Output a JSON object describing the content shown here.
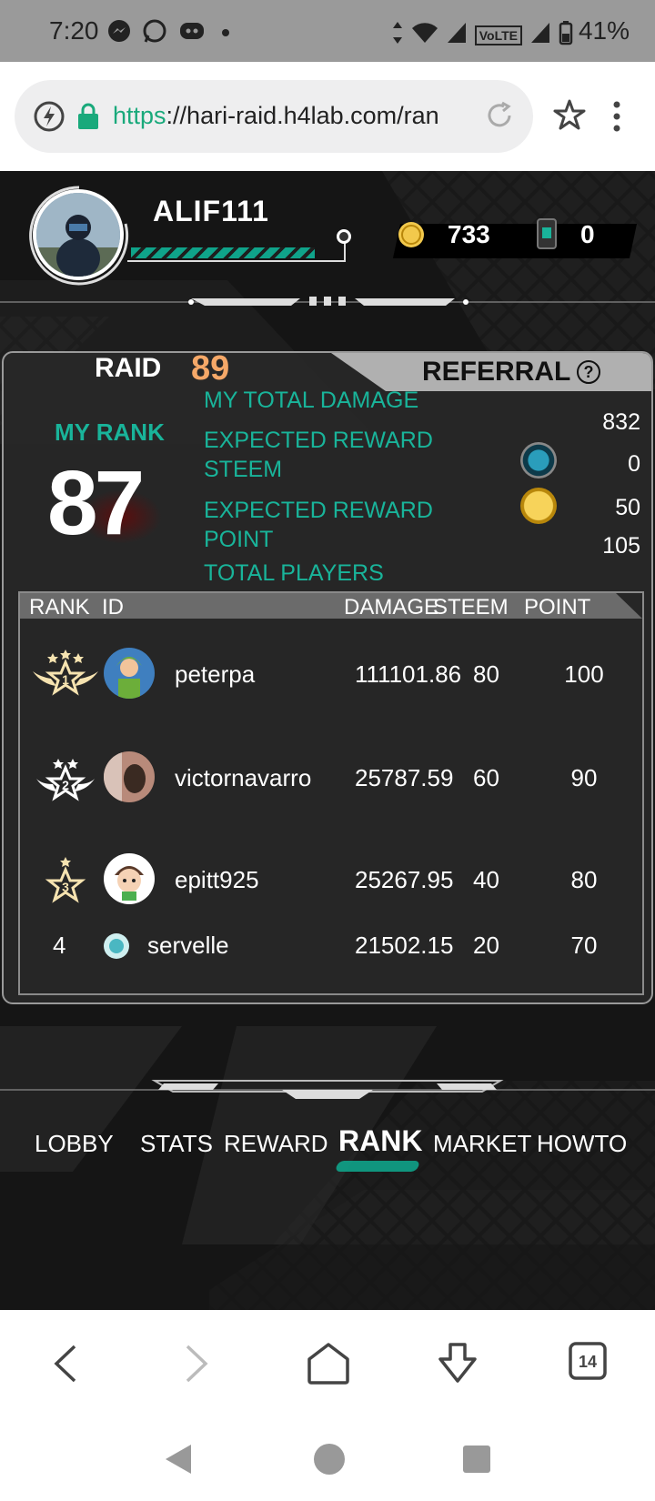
{
  "status_bar": {
    "time": "7:20",
    "battery": "41%",
    "volte": "VoLTE"
  },
  "browser": {
    "url_scheme": "https",
    "url_rest": "://hari-raid.h4lab.com/ran",
    "tab_count": "14"
  },
  "player": {
    "name": "ALIF111",
    "xp_fraction": 0.92,
    "coins": "733",
    "cards": "0"
  },
  "tabs": {
    "raid_label": "RAID",
    "raid_number": "89",
    "referral_label": "REFERRAL",
    "help": "?"
  },
  "my_stats": {
    "rank_label": "MY RANK",
    "rank": "87",
    "total_damage_label": "MY TOTAL DAMAGE",
    "total_damage": "832",
    "expected_steem_label_1": "EXPECTED REWARD",
    "expected_steem_label_2": "STEEM",
    "expected_steem": "0",
    "expected_point_label_1": "EXPECTED REWARD",
    "expected_point_label_2": "POINT",
    "expected_point": "50",
    "total_players_label": "TOTAL PLAYERS",
    "total_players": "105"
  },
  "table": {
    "headers": {
      "rank": "RANK",
      "id": "ID",
      "damage": "DAMAGE",
      "steem": "STEEM",
      "point": "POINT"
    },
    "rows": [
      {
        "rank": "1",
        "id": "peterpa",
        "damage": "111101.86",
        "steem": "80",
        "point": "100"
      },
      {
        "rank": "2",
        "id": "victornavarro",
        "damage": "25787.59",
        "steem": "60",
        "point": "90"
      },
      {
        "rank": "3",
        "id": "epitt925",
        "damage": "25267.95",
        "steem": "40",
        "point": "80"
      },
      {
        "rank": "4",
        "id": "servelle",
        "damage": "21502.15",
        "steem": "20",
        "point": "70"
      }
    ]
  },
  "nav": {
    "lobby": "LOBBY",
    "stats": "STATS",
    "reward": "REWARD",
    "rank": "RANK",
    "market": "MARKET",
    "howto": "HOWTO"
  },
  "colors": {
    "accent_teal": "#19b49a",
    "raid_orange": "#f5a868"
  }
}
